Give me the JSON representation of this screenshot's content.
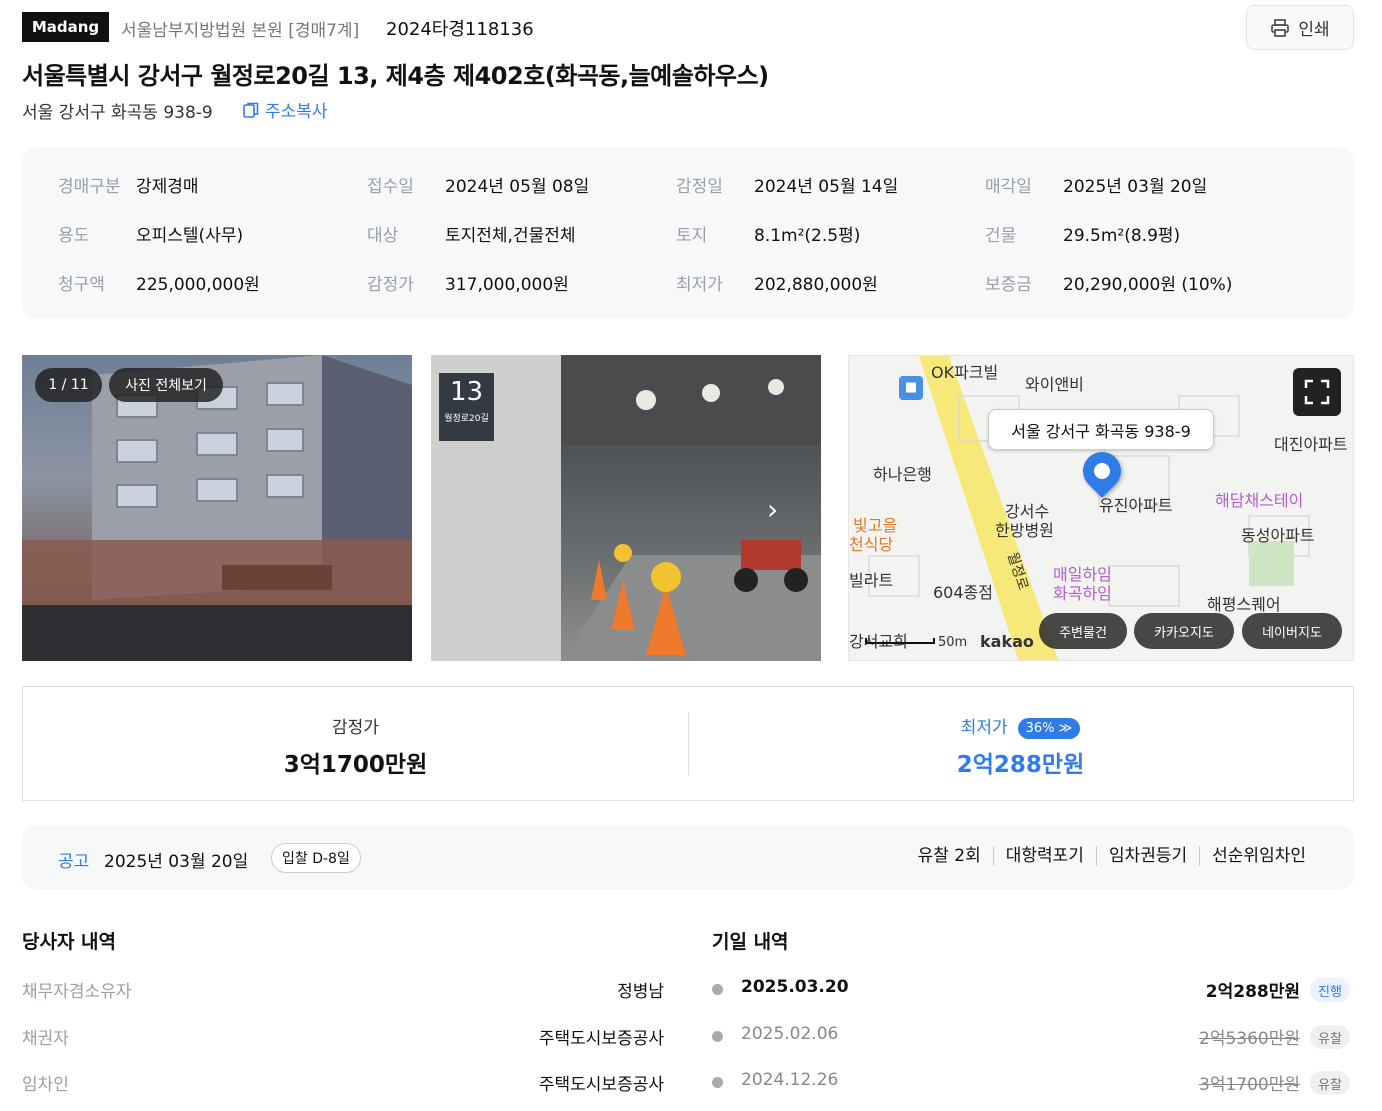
{
  "header": {
    "logo": "Madang",
    "court": "서울남부지방법원 본원 [경매7계]",
    "case_no": "2024타경118136",
    "print_label": "인쇄",
    "title": "서울특별시 강서구 월정로20길 13, 제4층 제402호(화곡동,늘예솔하우스)",
    "jibun": "서울 강서구 화곡동 938-9",
    "copy_label": "주소복사"
  },
  "info": {
    "rows": [
      [
        {
          "k": "경매구분",
          "v": "강제경매"
        },
        {
          "k": "접수일",
          "v": "2024년 05월 08일"
        },
        {
          "k": "감정일",
          "v": "2024년 05월 14일"
        },
        {
          "k": "매각일",
          "v": "2025년 03월 20일"
        }
      ],
      [
        {
          "k": "용도",
          "v": "오피스텔(사무)"
        },
        {
          "k": "대상",
          "v": "토지전체,건물전체"
        },
        {
          "k": "토지",
          "v": "8.1m²(2.5평)"
        },
        {
          "k": "건물",
          "v": "29.5m²(8.9평)"
        }
      ],
      [
        {
          "k": "청구액",
          "v": "225,000,000원"
        },
        {
          "k": "감정가",
          "v": "317,000,000원"
        },
        {
          "k": "최저가",
          "v": "202,880,000원"
        },
        {
          "k": "보증금",
          "v": "20,290,000원 (10%)"
        }
      ]
    ]
  },
  "media": {
    "photo_counter": "1 / 11",
    "photo_all_label": "사진 전체보기",
    "plate_number": "13",
    "plate_text": "월정로20길",
    "map": {
      "callout": "서울 강서구 화곡동 938-9",
      "labels": [
        "OK파크빌",
        "와이앤비",
        "대진아파트",
        "하나은행",
        "강서수",
        "한방병원",
        "유진아파트",
        "해담채스테이",
        "빛고을",
        "천식당",
        "동성아파트",
        "빌라트",
        "604종점",
        "매일하임",
        "화곡하임",
        "해평스퀘어",
        "강서교회",
        "kakao"
      ],
      "road_label": "월정로",
      "scale": "50m",
      "buttons": [
        "주변물건",
        "카카오지도",
        "네이버지도"
      ]
    }
  },
  "price": {
    "appraisal_label": "감정가",
    "appraisal_value": "3억1700만원",
    "min_label": "최저가",
    "min_pct": "36%",
    "min_value": "2억288만원",
    "accent": "#2f7ce8"
  },
  "notice": {
    "label": "공고",
    "date": "2025년 03월 20일",
    "dday": "입찰 D-8일",
    "tags": [
      "유찰 2회",
      "대항력포기",
      "임차권등기",
      "선순위임차인"
    ]
  },
  "parties": {
    "title": "당사자 내역",
    "rows": [
      {
        "k": "채무자겸소유자",
        "v": "정병남"
      },
      {
        "k": "채권자",
        "v": "주택도시보증공사"
      },
      {
        "k": "임차인",
        "v": "주택도시보증공사"
      }
    ]
  },
  "history": {
    "title": "기일 내역",
    "rows": [
      {
        "date": "2025.03.20",
        "price": "2억288만원",
        "status": "진행"
      },
      {
        "date": "2025.02.06",
        "price": "2억5360만원",
        "status": "유찰"
      },
      {
        "date": "2024.12.26",
        "price": "3억1700만원",
        "status": "유찰"
      }
    ]
  }
}
